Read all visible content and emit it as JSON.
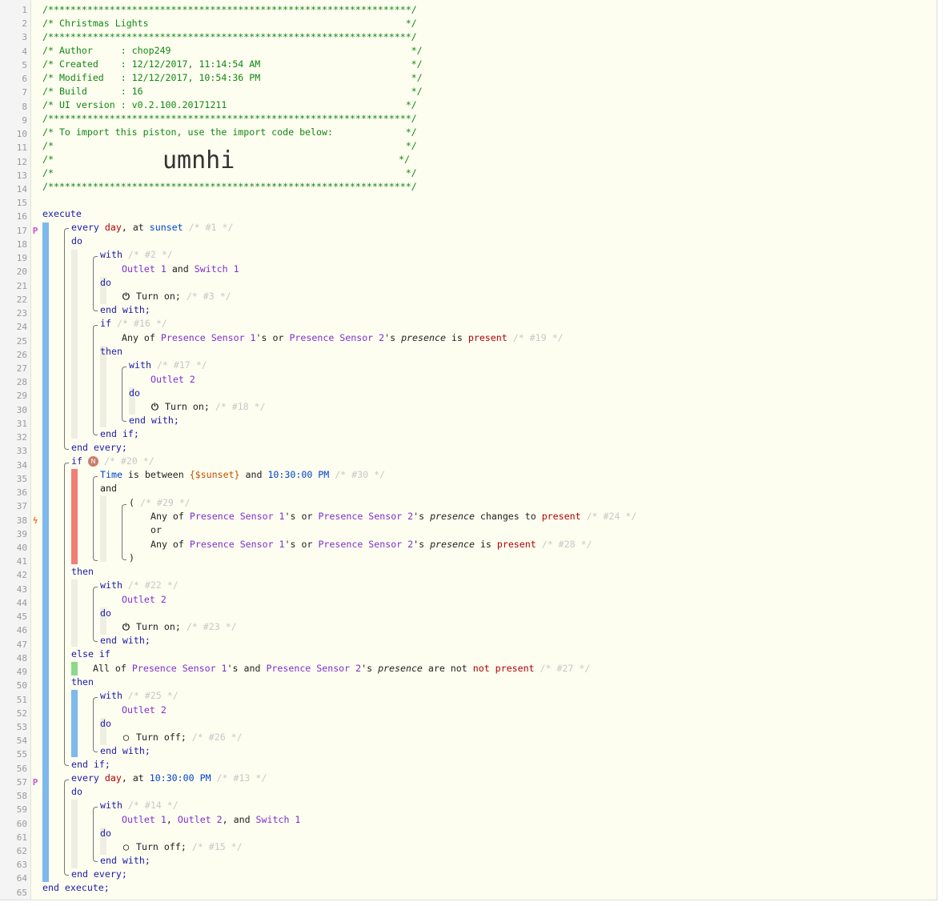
{
  "header": {
    "border_line": "/*****************************************************************/",
    "title_line": "/* Christmas Lights                                              */",
    "author_line": "/* Author     : chop249                                           */",
    "created_line": "/* Created    : 12/12/2017, 11:14:54 AM                           */",
    "modified_line": "/* Modified   : 12/12/2017, 10:54:36 PM                           */",
    "build_line": "/* Build      : 16                                                */",
    "ui_line": "/* UI version : v0.2.100.20171211                                */",
    "import_line": "/* To import this piston, use the import code below:             */",
    "blank_line": "/*                                                               */",
    "code_left": "/*",
    "code_right": "*/",
    "import_code": "umnhi"
  },
  "line_numbers": [
    "1",
    "2",
    "3",
    "4",
    "5",
    "6",
    "7",
    "8",
    "9",
    "10",
    "11",
    "12",
    "13",
    "14",
    "15",
    "16",
    "17",
    "18",
    "19",
    "20",
    "21",
    "22",
    "23",
    "24",
    "25",
    "26",
    "27",
    "28",
    "29",
    "30",
    "31",
    "32",
    "33",
    "34",
    "35",
    "36",
    "37",
    "38",
    "39",
    "40",
    "41",
    "42",
    "43",
    "44",
    "45",
    "46",
    "47",
    "48",
    "49",
    "50",
    "51",
    "52",
    "53",
    "54",
    "55",
    "56",
    "57",
    "58",
    "59",
    "60",
    "61",
    "62",
    "63",
    "64",
    "65"
  ],
  "markers": {
    "pin": "P",
    "bolt": "ϟ"
  },
  "icons": {
    "power": "⏻",
    "power_off": "◯",
    "condition_badge": "N"
  },
  "tokens": {
    "execute": "execute",
    "end_execute": "end execute;",
    "every": "every",
    "day": "day",
    "comma": ",",
    "at": "at",
    "sunset": "sunset",
    "do": "do",
    "with": "with",
    "and": "and",
    "end_with": "end with;",
    "turn_on": "Turn on;",
    "turn_off": "Turn off;",
    "if": "if",
    "then": "then",
    "end_if": "end if;",
    "end_every": "end every;",
    "else_if": "else if",
    "any_of": "Any of",
    "all_of": "All of",
    "or": "or",
    "s": "'s",
    "presence": "presence",
    "is": "is",
    "present": "present",
    "changes_to": "changes to",
    "are_not": "are not",
    "not_present": "not present",
    "time": "Time",
    "is_between": "is between",
    "sunset_var": "{$sunset}",
    "time_1030": "10:30:00 PM",
    "open_paren": "(",
    "close_paren": ")",
    "comma_and": ", and"
  },
  "devices": {
    "outlet1": "Outlet 1",
    "outlet2": "Outlet 2",
    "switch1": "Switch 1",
    "ps1": "Presence Sensor 1",
    "ps2": "Presence Sensor 2"
  },
  "comments": {
    "c1": "/* #1 */",
    "c2": "/* #2 */",
    "c3": "/* #3 */",
    "c13": "/* #13 */",
    "c14": "/* #14 */",
    "c15": "/* #15 */",
    "c16": "/* #16 */",
    "c17": "/* #17 */",
    "c18": "/* #18 */",
    "c19": "/* #19 */",
    "c20": "/* #20 */",
    "c22": "/* #22 */",
    "c23": "/* #23 */",
    "c24": "/* #24 */",
    "c25": "/* #25 */",
    "c26": "/* #26 */",
    "c27": "/* #27 */",
    "c28": "/* #28 */",
    "c29": "/* #29 */",
    "c30": "/* #30 */"
  },
  "colors": {
    "keyword": "#1a1aa8",
    "device": "#7f2fd1",
    "value": "#b00000",
    "header_comment": "#128812",
    "comment": "#c8c8c8",
    "block_bar": "#7db9ec",
    "condition_bar": "#f08077",
    "else_bar": "#8bd98b"
  }
}
